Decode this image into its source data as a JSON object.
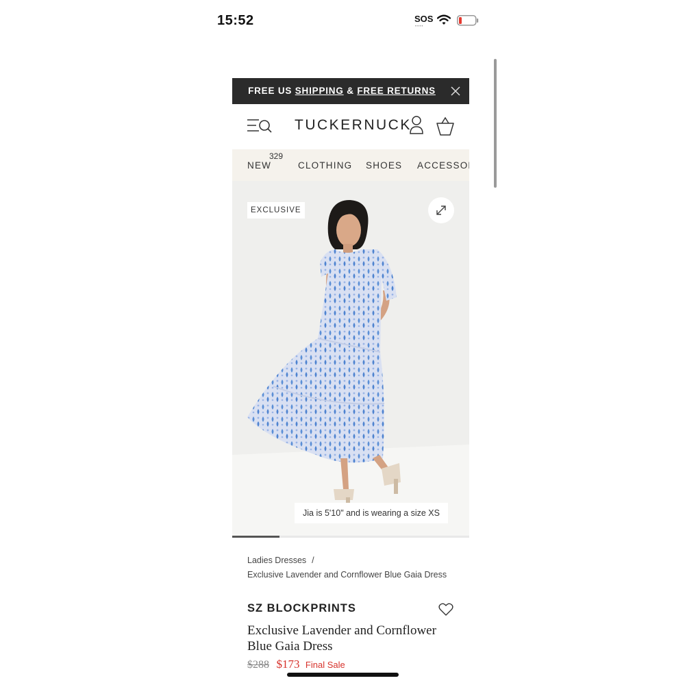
{
  "status_bar": {
    "time": "15:52",
    "carrier": "SOS",
    "carrier_dots": "••••"
  },
  "promo": {
    "prefix": "FREE US ",
    "shipping": "SHIPPING",
    "amp": " & ",
    "returns": "FREE RETURNS",
    "close_icon": "close-icon"
  },
  "header": {
    "logo": "TUCKERNUCK",
    "menu_icon": "menu-search-icon",
    "account_icon": "account-icon",
    "bag_icon": "bag-icon"
  },
  "nav": {
    "items": [
      {
        "label": "NEW",
        "count": "329"
      },
      {
        "label": "CLOTHING"
      },
      {
        "label": "SHOES"
      },
      {
        "label": "ACCESSORIES"
      }
    ]
  },
  "product": {
    "badge": "EXCLUSIVE",
    "image_caption": "Jia is 5'10\" and is wearing a size XS",
    "gallery_progress": 0.2,
    "breadcrumbs": [
      "Ladies Dresses",
      "Exclusive Lavender and Cornflower Blue Gaia Dress"
    ],
    "breadcrumb_separator": "/",
    "brand": "SZ BLOCKPRINTS",
    "title": "Exclusive Lavender and Cornflower Blue Gaia Dress",
    "price_original": "$288",
    "price_sale": "$173",
    "sale_note": "Final Sale"
  },
  "colors": {
    "promo_bg": "#2b2b2b",
    "nav_bg": "#f5f2ec",
    "sale_red": "#d7322b"
  }
}
